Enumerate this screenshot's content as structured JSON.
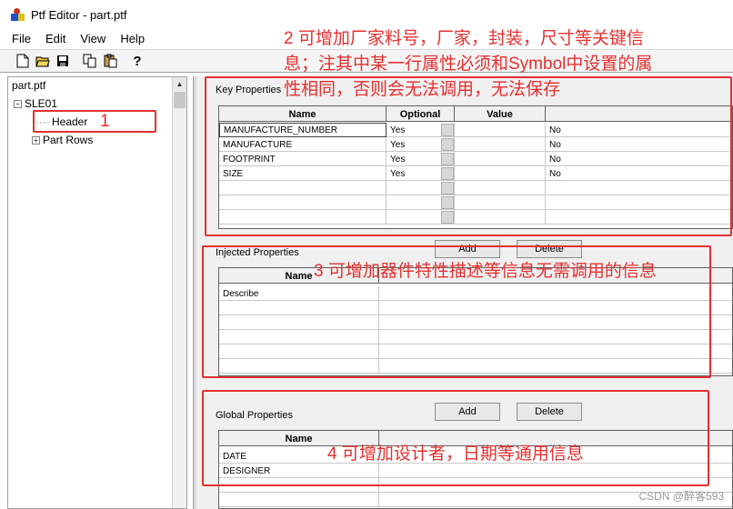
{
  "window": {
    "title": "Ptf Editor - part.ptf"
  },
  "menu": [
    "File",
    "Edit",
    "View",
    "Help"
  ],
  "toolbar": {
    "new_icon": "□",
    "open_icon": "📂",
    "save_icon": "■",
    "copy_icon": "⧉",
    "paste_icon": "📋",
    "help_icon": "?"
  },
  "tree": {
    "root": "part.ptf",
    "package": "SLE01",
    "header": "Header",
    "part_rows": "Part Rows",
    "expanded_sign": "−",
    "collapsed_sign": "+"
  },
  "key_properties": {
    "label": "Key Properties",
    "columns": [
      "Name",
      "Optional",
      "Value"
    ],
    "rows": [
      {
        "name": "MANUFACTURE_NUMBER",
        "optional": "Yes",
        "value": "No"
      },
      {
        "name": "MANUFACTURE",
        "optional": "Yes",
        "value": "No"
      },
      {
        "name": "FOOTPRINT",
        "optional": "Yes",
        "value": "No"
      },
      {
        "name": "SIZE",
        "optional": "Yes",
        "value": "No"
      }
    ]
  },
  "injected_properties": {
    "label": "Injected Properties",
    "add": "Add",
    "delete": "Delete",
    "column": "Name",
    "rows": [
      "Describe"
    ]
  },
  "global_properties": {
    "label": "Global Properties",
    "add": "Add",
    "delete": "Delete",
    "column": "Name",
    "rows": [
      "DATE",
      "DESIGNER"
    ]
  },
  "annotations": {
    "a1": "1",
    "a2_line1": "2 可增加厂家料号，厂家，封装，尺寸等关键信",
    "a2_line2": "息；注其中某一行属性必须和Symbol中设置的属",
    "a2_line3": "性相同，否则会无法调用，无法保存",
    "a3": "3 可增加器件特性描述等信息无需调用的信息",
    "a4": "4 可增加设计者，日期等通用信息"
  },
  "watermark": "CSDN @醉客593",
  "colors": {
    "annotation_red": "#e53030"
  }
}
